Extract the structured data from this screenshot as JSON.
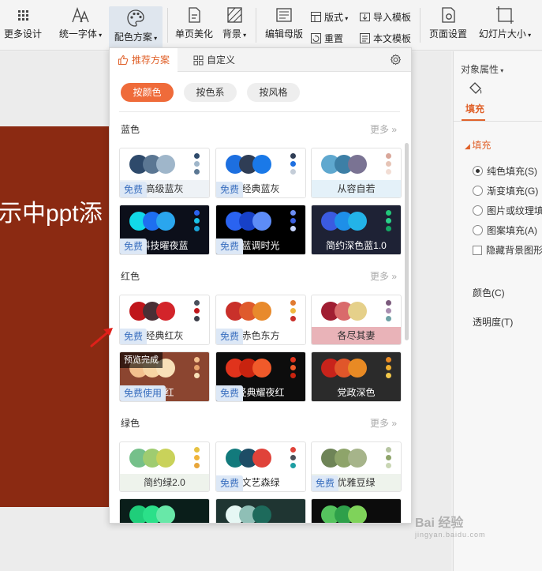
{
  "toolbar": {
    "more_design": "更多设计",
    "unify_font": "统一字体",
    "color_scheme": "配色方案",
    "single_page_beautify": "单页美化",
    "background": "背景",
    "edit_master": "编辑母版",
    "layout": "版式",
    "reset": "重置",
    "import_template": "导入模板",
    "text_template": "本文模板",
    "page_setup": "页面设置",
    "slide_size": "幻灯片大小"
  },
  "slide": {
    "text": "示中ppt添"
  },
  "right_panel": {
    "title": "对象属性",
    "tab_fill": "填充",
    "section_fill": "填充",
    "options": [
      "纯色填充(S)",
      "渐变填充(G)",
      "图片或纹理填",
      "图案填充(A)"
    ],
    "hide_bg": "隐藏背景图形",
    "color_label": "颜色(C)",
    "transparency_label": "透明度(T)"
  },
  "panel": {
    "tab_recommended": "推荐方案",
    "tab_custom": "自定义",
    "pills": [
      "按颜色",
      "按色系",
      "按风格"
    ],
    "more": "更多 »",
    "groups": [
      {
        "title": "蓝色",
        "cards": [
          {
            "label": "高级蓝灰",
            "badge": "免费",
            "bg": "#ffffff",
            "labelbg": "#eef2f6",
            "labelcolor": "#333333",
            "circles": [
              "#2e4a6b",
              "#5b7793",
              "#9fb6ca"
            ],
            "dots": [
              "#2e4a6b",
              "#9fb6ca",
              "#5b7793"
            ]
          },
          {
            "label": "经典蓝灰",
            "badge": "免费",
            "bg": "#ffffff",
            "labelbg": "#ffffff",
            "labelcolor": "#333333",
            "circles": [
              "#1d6fe0",
              "#2f3d55",
              "#1a79e8"
            ],
            "dots": [
              "#2f3d55",
              "#1d6fe0",
              "#c4cdd8"
            ]
          },
          {
            "label": "从容自若",
            "badge": "",
            "bg": "#ffffff",
            "labelbg": "#e4f1f9",
            "labelcolor": "#333333",
            "circles": [
              "#5fa8cf",
              "#3d7fa6",
              "#7a7393"
            ],
            "dots": [
              "#d9a79a",
              "#e6c4b6",
              "#f2ddd4"
            ]
          },
          {
            "label": "科技曜夜蓝",
            "badge": "免费",
            "bg": "#0c0f1a",
            "labelbg": "#0c0f1a",
            "labelcolor": "#ffffff",
            "circles": [
              "#12d9e8",
              "#1e6ff0",
              "#2aa6ee"
            ],
            "dots": [
              "#2b63f0",
              "#1ac2e8",
              "#1aa4d8"
            ]
          },
          {
            "label": "蓝调时光",
            "badge": "免费",
            "bg": "#000000",
            "labelbg": "#000000",
            "labelcolor": "#ffffff",
            "circles": [
              "#2a63f0",
              "#1741c8",
              "#5d8cf7"
            ],
            "dots": [
              "#6c8ef5",
              "#3a5fe0",
              "#c6d4fb"
            ]
          },
          {
            "label": "简约深色蓝1.0",
            "badge": "",
            "bg": "#1e2235",
            "labelbg": "#1e2235",
            "labelcolor": "#ffffff",
            "circles": [
              "#3b5be0",
              "#1e8fe8",
              "#23b3e8"
            ],
            "dots": [
              "#22c77a",
              "#2ad38a",
              "#14a764"
            ]
          }
        ]
      },
      {
        "title": "红色",
        "cards": [
          {
            "label": "经典红灰",
            "badge": "免费",
            "bg": "#ffffff",
            "labelbg": "#ffffff",
            "labelcolor": "#333333",
            "circles": [
              "#c0161b",
              "#4a2f35",
              "#d3242a"
            ],
            "dots": [
              "#4a4f5c",
              "#c0161b",
              "#3d3f4a"
            ]
          },
          {
            "label": "赤色东方",
            "badge": "免费",
            "bg": "#ffffff",
            "labelbg": "#ffffff",
            "labelcolor": "#333333",
            "circles": [
              "#c9302a",
              "#df5a2c",
              "#e88a2c"
            ],
            "dots": [
              "#e07a30",
              "#f0b840",
              "#c9302a"
            ]
          },
          {
            "label": "各尽其妻",
            "badge": "",
            "bg": "#ffffff",
            "labelbg": "#e9b3b8",
            "labelcolor": "#333333",
            "circles": [
              "#a01e32",
              "#d96b6b",
              "#e5d08a"
            ],
            "dots": [
              "#7b5a7c",
              "#a98eb0",
              "#6fa2a6"
            ]
          },
          {
            "label": "深红",
            "badge": "免费使用",
            "tip": "预览完成",
            "bg": "#8b4530",
            "labelbg": "#8b4530",
            "labelcolor": "#ffffff",
            "circles": [
              "#f3c08e",
              "#f6d4a4",
              "#f8e0b8"
            ],
            "dots": [
              "#f3c08e",
              "#e8a36c",
              "#f8e0b8"
            ]
          },
          {
            "label": "经典耀夜红",
            "badge": "免费",
            "bg": "#0d0d0d",
            "labelbg": "#0d0d0d",
            "labelcolor": "#ffffff",
            "circles": [
              "#e0331c",
              "#c8230f",
              "#f05a2a"
            ],
            "dots": [
              "#e0331c",
              "#f05a2a",
              "#c8230f"
            ]
          },
          {
            "label": "党政深色",
            "badge": "",
            "bg": "#2b2b2b",
            "labelbg": "#2b2b2b",
            "labelcolor": "#ffffff",
            "circles": [
              "#c8231b",
              "#e0562a",
              "#e88a24"
            ],
            "dots": [
              "#e88a24",
              "#f0b030",
              "#f2c84a"
            ]
          }
        ]
      },
      {
        "title": "绿色",
        "cards": [
          {
            "label": "简约绿2.0",
            "badge": "",
            "bg": "#ffffff",
            "labelbg": "#eef3ec",
            "labelcolor": "#333333",
            "circles": [
              "#75c08a",
              "#9fcc70",
              "#c9d25a"
            ],
            "dots": [
              "#e6c242",
              "#f0b43a",
              "#e8a63a"
            ]
          },
          {
            "label": "文艺森绿",
            "badge": "免费",
            "bg": "#ffffff",
            "labelbg": "#ffffff",
            "labelcolor": "#333333",
            "circles": [
              "#127a7c",
              "#1d4d66",
              "#e0433a"
            ],
            "dots": [
              "#e0433a",
              "#4a5058",
              "#1d9ea3"
            ]
          },
          {
            "label": "优雅豆绿",
            "badge": "免费",
            "bg": "#ffffff",
            "labelbg": "#eef3ec",
            "labelcolor": "#333333",
            "circles": [
              "#6e8457",
              "#8ea46a",
              "#a6b48a"
            ],
            "dots": [
              "#b7c5a2",
              "#8ea46a",
              "#c9d6b4"
            ]
          },
          {
            "label": "",
            "badge": "",
            "bg": "#0a1e1a",
            "labelbg": "#0a1e1a",
            "labelcolor": "#ffffff",
            "circles": [
              "#1fce7a",
              "#2be089",
              "#68e8a8"
            ],
            "dots": []
          },
          {
            "label": "",
            "badge": "",
            "bg": "#1f3532",
            "labelbg": "#1f3532",
            "labelcolor": "#ffffff",
            "circles": [
              "#e6f7f4",
              "#8fbfb6",
              "#1d6a5b"
            ],
            "dots": []
          },
          {
            "label": "",
            "badge": "",
            "bg": "#0c0c0c",
            "labelbg": "#0c0c0c",
            "labelcolor": "#ffffff",
            "circles": [
              "#55c35e",
              "#2ea04a",
              "#7fd35a"
            ],
            "dots": []
          }
        ]
      }
    ]
  },
  "watermark": {
    "main": "Bai 经验",
    "sub": "jingyan.baidu.com"
  },
  "colors": {
    "accent": "#e0622b",
    "slide_bg": "#8b2a12",
    "badge_bg": "#dde8f6",
    "badge_text": "#3a6fbf"
  }
}
